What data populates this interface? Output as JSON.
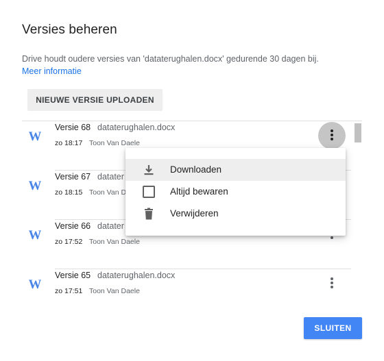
{
  "dialog": {
    "title": "Versies beheren",
    "description": "Drive houdt oudere versies van 'dataterughalen.docx' gedurende 30 dagen bij.",
    "more_info_link": "Meer informatie",
    "upload_button": "NIEUWE VERSIE UPLOADEN",
    "close_button": "SLUITEN"
  },
  "versions": [
    {
      "label": "Versie 68",
      "file": "dataterughalen.docx",
      "time": "zo 18:17",
      "author": "Toon Van Daele"
    },
    {
      "label": "Versie 67",
      "file": "datater",
      "time": "zo 18:15",
      "author": "Toon Van Dae"
    },
    {
      "label": "Versie 66",
      "file": "datater",
      "time": "zo 17:52",
      "author": "Toon Van Daele"
    },
    {
      "label": "Versie 65",
      "file": "dataterughalen.docx",
      "time": "zo 17:51",
      "author": "Toon Van Daele"
    }
  ],
  "context_menu": {
    "items": [
      {
        "label": "Downloaden",
        "icon": "download-icon"
      },
      {
        "label": "Altijd bewaren",
        "icon": "checkbox-icon"
      },
      {
        "label": "Verwijderen",
        "icon": "trash-icon"
      }
    ]
  },
  "colors": {
    "accent": "#4285f4",
    "link": "#1a73e8",
    "word_icon": "#4a86e8"
  }
}
